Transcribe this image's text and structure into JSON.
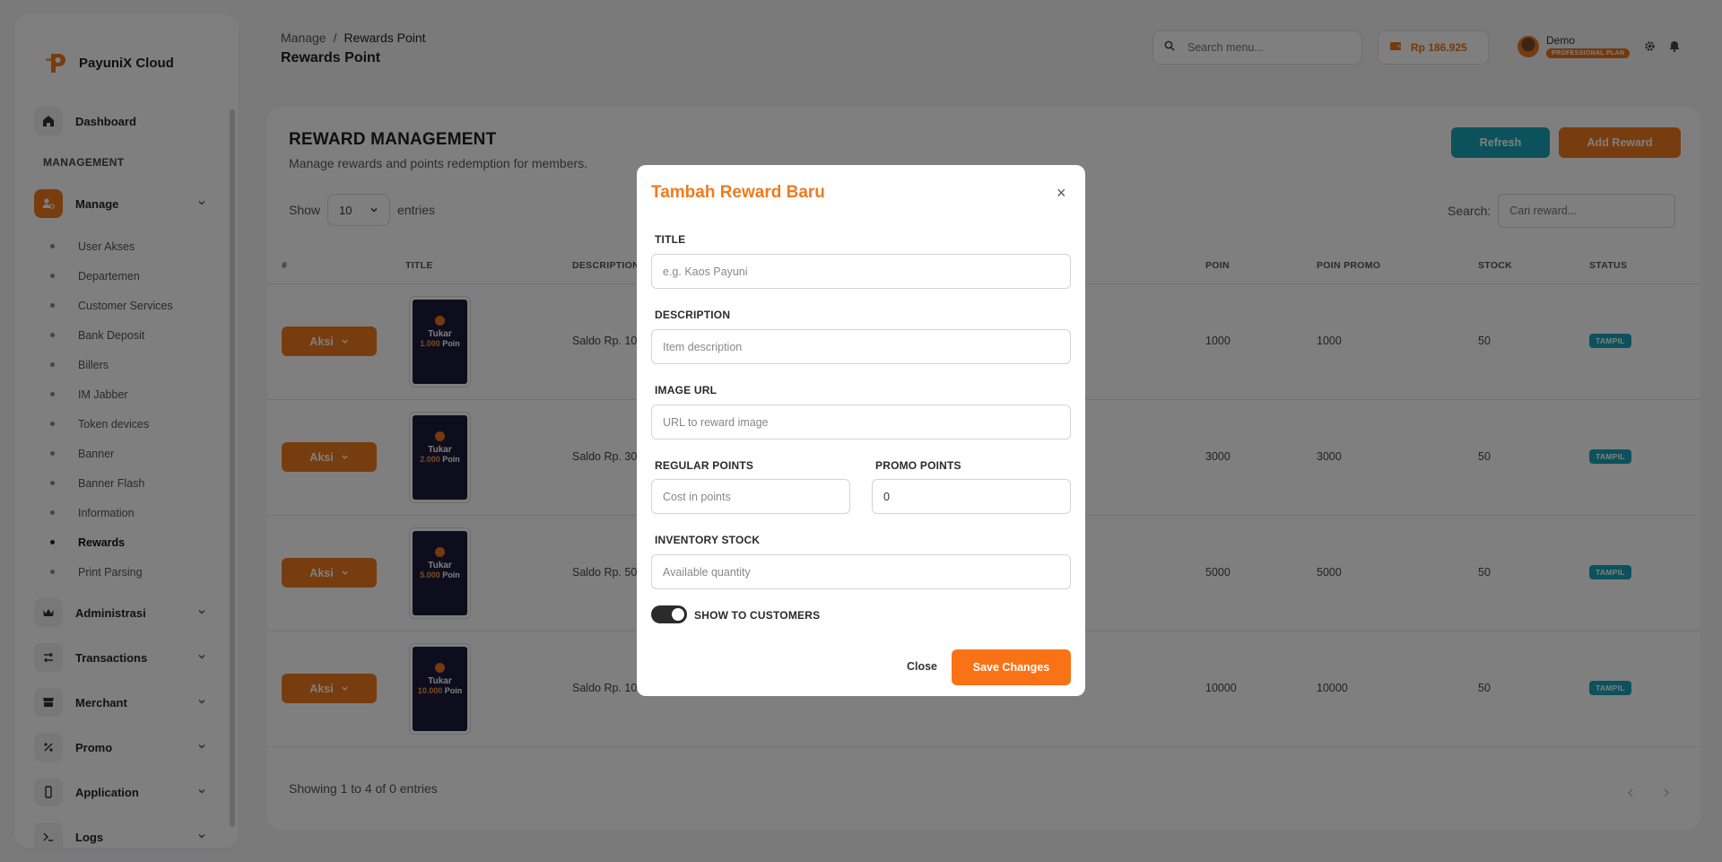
{
  "brand": {
    "name": "PayuniX Cloud",
    "logo_icon": "payunix-logo-icon",
    "accent": "#f07a1f"
  },
  "sidebar": {
    "dashboard": {
      "label": "Dashboard",
      "icon": "home-icon"
    },
    "section_management": "MANAGEMENT",
    "manage": {
      "label": "Manage",
      "icon": "user-manage-icon"
    },
    "sub_items": [
      {
        "label": "User Akses"
      },
      {
        "label": "Departemen"
      },
      {
        "label": "Customer Services"
      },
      {
        "label": "Bank Deposit"
      },
      {
        "label": "Billers"
      },
      {
        "label": "IM Jabber"
      },
      {
        "label": "Token devices"
      },
      {
        "label": "Banner"
      },
      {
        "label": "Banner Flash"
      },
      {
        "label": "Information"
      },
      {
        "label": "Rewards"
      },
      {
        "label": "Print Parsing"
      }
    ],
    "active_sub": "Rewards",
    "groups": [
      {
        "label": "Administrasi",
        "icon": "crown-icon"
      },
      {
        "label": "Transactions",
        "icon": "swap-icon"
      },
      {
        "label": "Merchant",
        "icon": "store-icon"
      },
      {
        "label": "Promo",
        "icon": "percent-icon"
      },
      {
        "label": "Application",
        "icon": "phone-icon"
      },
      {
        "label": "Logs",
        "icon": "terminal-icon"
      }
    ]
  },
  "header": {
    "breadcrumb": [
      "Manage",
      "Rewards Point"
    ],
    "title": "Rewards Point",
    "search_placeholder": "Search menu...",
    "balance": "Rp 186.925",
    "user_name": "Demo",
    "plan": "PROFESSIONAL PLAN"
  },
  "card": {
    "title": "REWARD MANAGEMENT",
    "subtitle": "Manage rewards and points redemption for members.",
    "refresh_label": "Refresh",
    "add_label": "Add Reward",
    "show_label": "Show",
    "entries_value": "10",
    "entries_label": "entries",
    "search_label": "Search:",
    "search_placeholder": "Cari reward...",
    "columns": [
      "#",
      "TITLE",
      "DESCRIPTION",
      "POIN",
      "POIN PROMO",
      "STOCK",
      "STATUS"
    ],
    "rows": [
      {
        "aksi": "Aksi",
        "thumb_title": "Tukar",
        "thumb_amount": "1.000",
        "thumb_unit": "Poin",
        "description": "Saldo Rp. 10.",
        "poin": "1000",
        "poin_promo": "1000",
        "stock": "50",
        "status": "TAMPIL"
      },
      {
        "aksi": "Aksi",
        "thumb_title": "Tukar",
        "thumb_amount": "2.000",
        "thumb_unit": "Poin",
        "description": "Saldo Rp. 30",
        "poin": "3000",
        "poin_promo": "3000",
        "stock": "50",
        "status": "TAMPIL"
      },
      {
        "aksi": "Aksi",
        "thumb_title": "Tukar",
        "thumb_amount": "5.000",
        "thumb_unit": "Poin",
        "description": "Saldo Rp. 50",
        "poin": "5000",
        "poin_promo": "5000",
        "stock": "50",
        "status": "TAMPIL"
      },
      {
        "aksi": "Aksi",
        "thumb_title": "Tukar",
        "thumb_amount": "10.000",
        "thumb_unit": "Poin",
        "description": "Saldo Rp. 10(",
        "poin": "10000",
        "poin_promo": "10000",
        "stock": "50",
        "status": "TAMPIL"
      }
    ],
    "footer": "Showing 1 to 4 of 0 entries"
  },
  "modal": {
    "title": "Tambah Reward Baru",
    "close_glyph": "×",
    "title_label": "TITLE",
    "title_placeholder": "e.g. Kaos Payuni",
    "description_label": "DESCRIPTION",
    "description_placeholder": "Item description",
    "image_label": "IMAGE URL",
    "image_placeholder": "URL to reward image",
    "regular_label": "REGULAR POINTS",
    "regular_placeholder": "Cost in points",
    "promo_label": "PROMO POINTS",
    "promo_value": "0",
    "stock_label": "INVENTORY STOCK",
    "stock_placeholder": "Available quantity",
    "toggle_label": "SHOW TO CUSTOMERS",
    "toggle_on": true,
    "close_label": "Close",
    "save_label": "Save Changes"
  }
}
